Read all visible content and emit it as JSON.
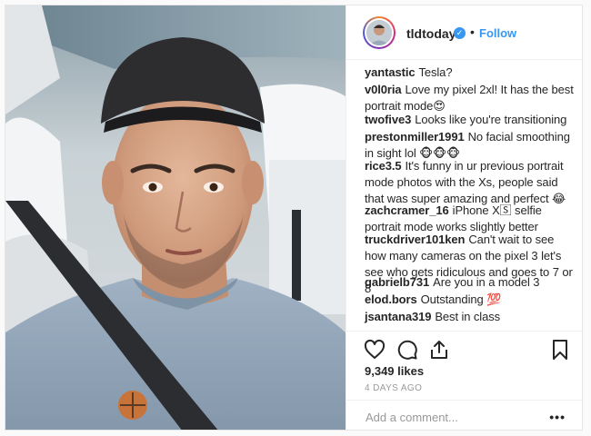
{
  "header": {
    "username": "tldtoday",
    "separator": "•",
    "follow_label": "Follow",
    "verified_glyph": "✓"
  },
  "comments": [
    {
      "user": "yantastic",
      "text": "Tesla?"
    },
    {
      "user": "v0l0ria",
      "text": "Love my pixel 2xl! It has the best portrait mode😍"
    },
    {
      "user": "twofive3",
      "text": "Looks like you're transitioning"
    },
    {
      "user": "prestonmiller1991",
      "text": "No facial smoothing in sight lol 🐵🐵🐵"
    },
    {
      "user": "rice3.5",
      "text": "It's funny in ur previous portrait mode photos with the Xs, people said that was super amazing and perfect 😂"
    },
    {
      "user": "zachcramer_16",
      "text": "iPhone X🅂 selfie portrait mode works slightly better"
    },
    {
      "user": "truckdriver101ken",
      "text": "Can't wait to see how many cameras on the pixel 3 let's see who gets ridiculous and goes to 7 or 8"
    },
    {
      "user": "gabrielb731",
      "text": "Are you in a model 3"
    },
    {
      "user": "elod.bors",
      "text": "Outstanding 💯"
    },
    {
      "user": "jsantana319",
      "text": "Best in class"
    }
  ],
  "actions": {
    "likes": "9,349 likes",
    "time": "4 DAYS AGO",
    "icons": [
      "heart-icon",
      "comment-icon",
      "share-icon",
      "bookmark-icon"
    ]
  },
  "add_comment": {
    "placeholder": "Add a comment...",
    "more_label": "•••"
  },
  "colors": {
    "link_blue": "#3897f0",
    "text": "#262626",
    "muted": "#999999",
    "border": "#efefef"
  }
}
